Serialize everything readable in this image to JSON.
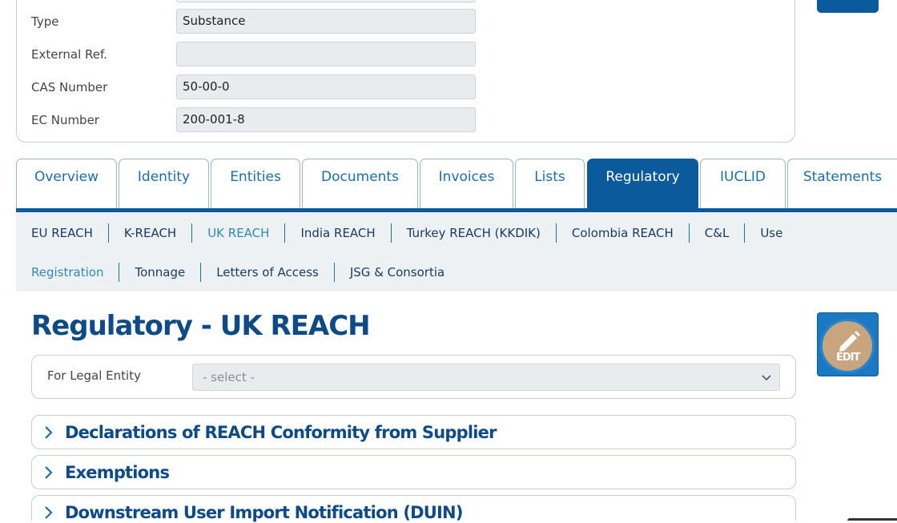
{
  "form": {
    "fields": [
      {
        "label": "Type",
        "value": "Substance"
      },
      {
        "label": "External Ref.",
        "value": ""
      },
      {
        "label": "CAS Number",
        "value": "50-00-0"
      },
      {
        "label": "EC Number",
        "value": "200-001-8"
      }
    ]
  },
  "tabs": [
    {
      "label": "Overview"
    },
    {
      "label": "Identity"
    },
    {
      "label": "Entities"
    },
    {
      "label": "Documents"
    },
    {
      "label": "Invoices"
    },
    {
      "label": "Lists"
    },
    {
      "label": "Regulatory",
      "active": true
    },
    {
      "label": "IUCLID"
    },
    {
      "label": "Statements"
    }
  ],
  "subnav": {
    "row1": [
      {
        "label": "EU REACH"
      },
      {
        "label": "K-REACH"
      },
      {
        "label": "UK REACH",
        "active": true
      },
      {
        "label": "India REACH"
      },
      {
        "label": "Turkey REACH (KKDIK)"
      },
      {
        "label": "Colombia REACH"
      },
      {
        "label": "C&L"
      },
      {
        "label": "Use"
      }
    ],
    "row2": [
      {
        "label": "Registration",
        "active": true
      },
      {
        "label": "Tonnage"
      },
      {
        "label": "Letters of Access"
      },
      {
        "label": "JSG & Consortia"
      }
    ]
  },
  "page": {
    "title": "Regulatory - UK REACH",
    "edit_label": "EDIT"
  },
  "legal_entity": {
    "label": "For Legal Entity",
    "select_value": "- select -"
  },
  "accordions": [
    {
      "title": "Declarations of REACH Conformity from Supplier"
    },
    {
      "title": "Exemptions"
    },
    {
      "title": "Downstream User Import Notification (DUIN)"
    }
  ],
  "colors": {
    "primary": "#0a5a9c",
    "heading": "#0d4a86",
    "link": "#1b6ea8",
    "subnav_bg": "#eef1f4"
  }
}
